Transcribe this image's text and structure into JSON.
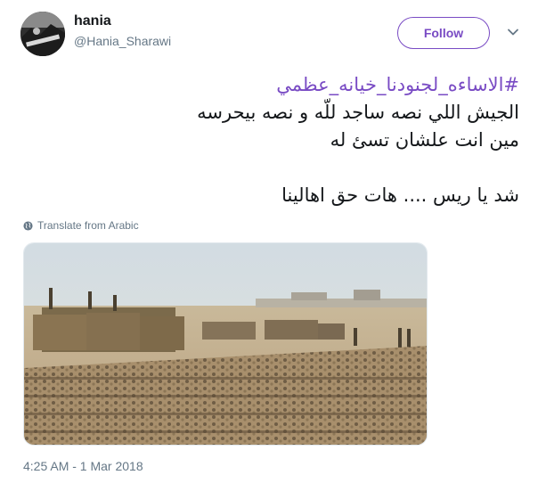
{
  "user": {
    "display_name": "hania",
    "handle": "@Hania_Sharawi"
  },
  "follow_label": "Follow",
  "tweet": {
    "hashtag": "#الاساءه_لجنودنا_خيانه_عظمي",
    "lines": [
      "الجيش اللي نصه ساجد للّه و نصه بيحرسه",
      "مين انت علشان تسئ له",
      "شد يا ريس .... هات حق اهالينا"
    ]
  },
  "translate_label": "Translate from Arabic",
  "timestamp": "4:25 AM - 1 Mar 2018",
  "colors": {
    "accent": "#794bc4",
    "secondary_text": "#657786",
    "primary_text": "#14171a"
  },
  "icons": [
    "chevron-down-icon",
    "globe-icon"
  ]
}
